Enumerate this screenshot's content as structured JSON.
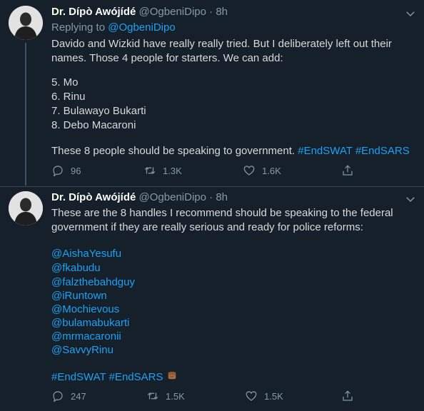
{
  "tweet1": {
    "author_name": "Dr. Dípò Awójídé",
    "author_handle": "@OgbeniDipo",
    "separator": "·",
    "time": "8h",
    "replying_to_prefix": "Replying to ",
    "replying_to_handle": "@OgbeniDipo",
    "lines": [
      "Davido and Wizkid have really really tried. But I deliberately left out their",
      "names. Those 4 people for starters. We can add:",
      "5. Mo",
      "6. Rinu",
      "7. Bulawayo Bukarti",
      "8. Debo Macaroni"
    ],
    "last_line_text": "These 8 people should be speaking to government. ",
    "hashtags": [
      "#EndSWAT",
      "#EndSARS"
    ],
    "actions": {
      "replies": "96",
      "retweets": "1.3K",
      "likes": "1.6K"
    }
  },
  "tweet2": {
    "author_name": "Dr. Dípò Awójídé",
    "author_handle": "@OgbeniDipo",
    "separator": "·",
    "time": "8h",
    "lines": [
      "These are the 8 handles I recommend should be speaking to the federal",
      "government if they are really serious and ready for police reforms:"
    ],
    "handles": [
      "@AishaYesufu",
      "@fkabudu",
      "@falzthebahdguy",
      "@iRuntown",
      "@Mochievous",
      "@bulamabukarti",
      "@mrmacaronii",
      "@SavvyRinu"
    ],
    "hashtags": [
      "#EndSWAT",
      "#EndSARS"
    ],
    "emoji": "raised-fist-dark-skin",
    "actions": {
      "replies": "247",
      "retweets": "1.5K",
      "likes": "1.5K"
    }
  },
  "colors": {
    "background": "#15202b",
    "link": "#1da1f2",
    "secondary_text": "#8899a6",
    "primary_text": "#d9d9d9",
    "divider": "#38444d"
  }
}
